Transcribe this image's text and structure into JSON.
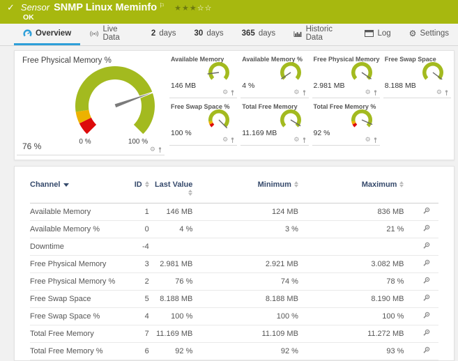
{
  "colors": {
    "header_green": "#a7b80f",
    "gauge_green": "#a3ba1f",
    "gauge_amber": "#edb200",
    "gauge_red": "#dd0b0b",
    "accent_blue": "#2e9fd9",
    "table_header_navy": "#35496b"
  },
  "header": {
    "kind_label": "Sensor",
    "title": "SNMP Linux Meminfo",
    "status": "OK",
    "priority_filled": 3,
    "priority_total": 5
  },
  "tabs": [
    {
      "label": "Overview",
      "icon": "overview-gauge-icon",
      "active": true
    },
    {
      "label": "Live Data",
      "icon": "live-data-icon"
    },
    {
      "num": "2",
      "label": "days"
    },
    {
      "num": "30",
      "label": "days"
    },
    {
      "num": "365",
      "label": "days"
    },
    {
      "label": "Historic Data",
      "icon": "historic-data-icon"
    },
    {
      "label": "Log",
      "icon": "log-icon"
    },
    {
      "label": "Settings",
      "icon": "settings-gear-icon"
    }
  ],
  "overview": {
    "main_gauge": {
      "title": "Free Physical Memory %",
      "value": "76 %",
      "min_label": "0 %",
      "max_label": "100 %",
      "needle_pct": 76,
      "warning": true
    },
    "small_gauges": [
      {
        "title": "Available Memory",
        "value": "146 MB",
        "needle_pct": 14,
        "warning": false
      },
      {
        "title": "Available Memory %",
        "value": "4 %",
        "needle_pct": 4,
        "warning": false
      },
      {
        "title": "Free Physical Memory",
        "value": "2.981 MB",
        "needle_pct": 96,
        "warning": false
      },
      {
        "title": "Free Swap Space",
        "value": "8.188 MB",
        "needle_pct": 97,
        "warning": false
      },
      {
        "title": "Free Swap Space %",
        "value": "100 %",
        "needle_pct": 100,
        "warning": true
      },
      {
        "title": "Total Free Memory",
        "value": "11.169 MB",
        "needle_pct": 95,
        "warning": false
      },
      {
        "title": "Total Free Memory %",
        "value": "92 %",
        "needle_pct": 92,
        "warning": true
      }
    ]
  },
  "table": {
    "columns": {
      "channel": "Channel",
      "id": "ID",
      "last": "Last Value",
      "min": "Minimum",
      "max": "Maximum"
    },
    "rows": [
      {
        "channel": "Available Memory",
        "id": "1",
        "last": "146 MB",
        "min": "124 MB",
        "max": "836 MB"
      },
      {
        "channel": "Available Memory %",
        "id": "0",
        "last": "4 %",
        "min": "3 %",
        "max": "21 %"
      },
      {
        "channel": "Downtime",
        "id": "-4",
        "last": "",
        "min": "",
        "max": ""
      },
      {
        "channel": "Free Physical Memory",
        "id": "3",
        "last": "2.981 MB",
        "min": "2.921 MB",
        "max": "3.082 MB"
      },
      {
        "channel": "Free Physical Memory %",
        "id": "2",
        "last": "76 %",
        "min": "74 %",
        "max": "78 %"
      },
      {
        "channel": "Free Swap Space",
        "id": "5",
        "last": "8.188 MB",
        "min": "8.188 MB",
        "max": "8.190 MB"
      },
      {
        "channel": "Free Swap Space %",
        "id": "4",
        "last": "100 %",
        "min": "100 %",
        "max": "100 %"
      },
      {
        "channel": "Total Free Memory",
        "id": "7",
        "last": "11.169 MB",
        "min": "11.109 MB",
        "max": "11.272 MB"
      },
      {
        "channel": "Total Free Memory %",
        "id": "6",
        "last": "92 %",
        "min": "92 %",
        "max": "93 %"
      }
    ]
  }
}
